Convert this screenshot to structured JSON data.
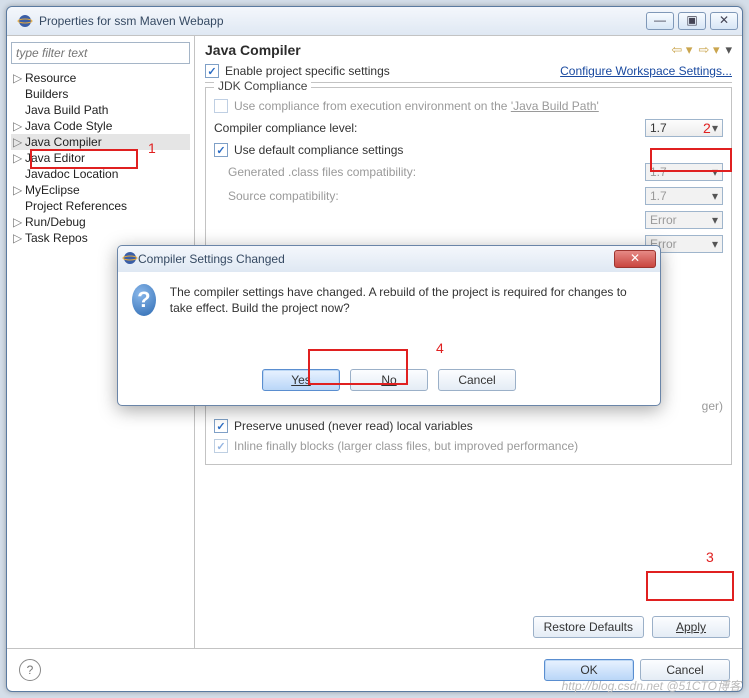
{
  "window": {
    "title": "Properties for ssm Maven Webapp"
  },
  "sidebar": {
    "filter_placeholder": "type filter text",
    "items": [
      {
        "label": "Resource",
        "expandable": true
      },
      {
        "label": "Builders",
        "expandable": false
      },
      {
        "label": "Java Build Path",
        "expandable": false
      },
      {
        "label": "Java Code Style",
        "expandable": true
      },
      {
        "label": "Java Compiler",
        "expandable": true,
        "selected": true
      },
      {
        "label": "Java Editor",
        "expandable": true
      },
      {
        "label": "Javadoc Location",
        "expandable": false
      },
      {
        "label": "MyEclipse",
        "expandable": true
      },
      {
        "label": "Project References",
        "expandable": false
      },
      {
        "label": "Run/Debug",
        "expandable": true
      },
      {
        "label": "Task Repos",
        "expandable": true
      }
    ]
  },
  "page": {
    "heading": "Java Compiler",
    "enable_project_specific": "Enable project specific settings",
    "configure_workspace_link": "Configure Workspace Settings...",
    "jdk_compliance": {
      "legend": "JDK Compliance",
      "use_exec_env_prefix": "Use compliance from execution environment on the ",
      "use_exec_env_link": "'Java Build Path'",
      "compliance_level_label": "Compiler compliance level:",
      "compliance_level_value": "1.7",
      "use_default": "Use default compliance settings",
      "rows": [
        {
          "label": "Generated .class files compatibility:",
          "value": "1.7",
          "disabled": true
        },
        {
          "label": "Source compatibility:",
          "value": "1.7",
          "disabled": true
        },
        {
          "label": "",
          "value": "Error",
          "disabled": true
        },
        {
          "label": "",
          "value": "Error",
          "disabled": true
        }
      ],
      "preserve_unused": "Preserve unused (never read) local variables",
      "inline_finally": "Inline finally blocks (larger class files, but improved performance)",
      "trailing_fragment": "ger)"
    },
    "restore_defaults": "Restore Defaults",
    "apply": "Apply",
    "ok": "OK",
    "cancel": "Cancel"
  },
  "dialog": {
    "title": "Compiler Settings Changed",
    "message": "The compiler settings have changed. A rebuild of the project is required for changes to take effect. Build the project now?",
    "yes": "Yes",
    "no": "No",
    "cancel": "Cancel"
  },
  "annotations": {
    "n1": "1",
    "n2": "2",
    "n3": "3",
    "n4": "4"
  },
  "watermark": "http://blog.csdn.net @51CTO博客"
}
